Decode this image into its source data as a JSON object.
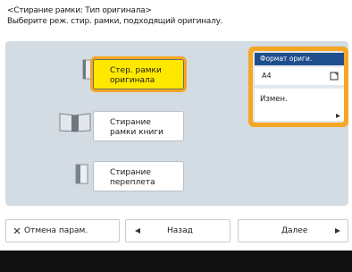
{
  "header": {
    "title": "<Стирание рамки: Тип оригинала>",
    "instruction": "Выберите реж. стир. рамки, подходящий оригиналу."
  },
  "options": [
    {
      "label_line1": "Стер. рамки",
      "label_line2": "оригинала",
      "selected": true
    },
    {
      "label_line1": "Стирание",
      "label_line2": "рамки книги",
      "selected": false
    },
    {
      "label_line1": "Стирание",
      "label_line2": "переплета",
      "selected": false
    }
  ],
  "format_panel": {
    "header": "Формат ориги.",
    "value": "A4",
    "change_label": "Измен."
  },
  "bottom": {
    "cancel_label": "Отмена парам.",
    "back_label": "Назад",
    "next_label": "Далее"
  },
  "colors": {
    "accent": "#f5a623",
    "selected_fill": "#ffe800",
    "panel_bg": "#d3dbe3",
    "header_blue": "#1f4e8c"
  }
}
